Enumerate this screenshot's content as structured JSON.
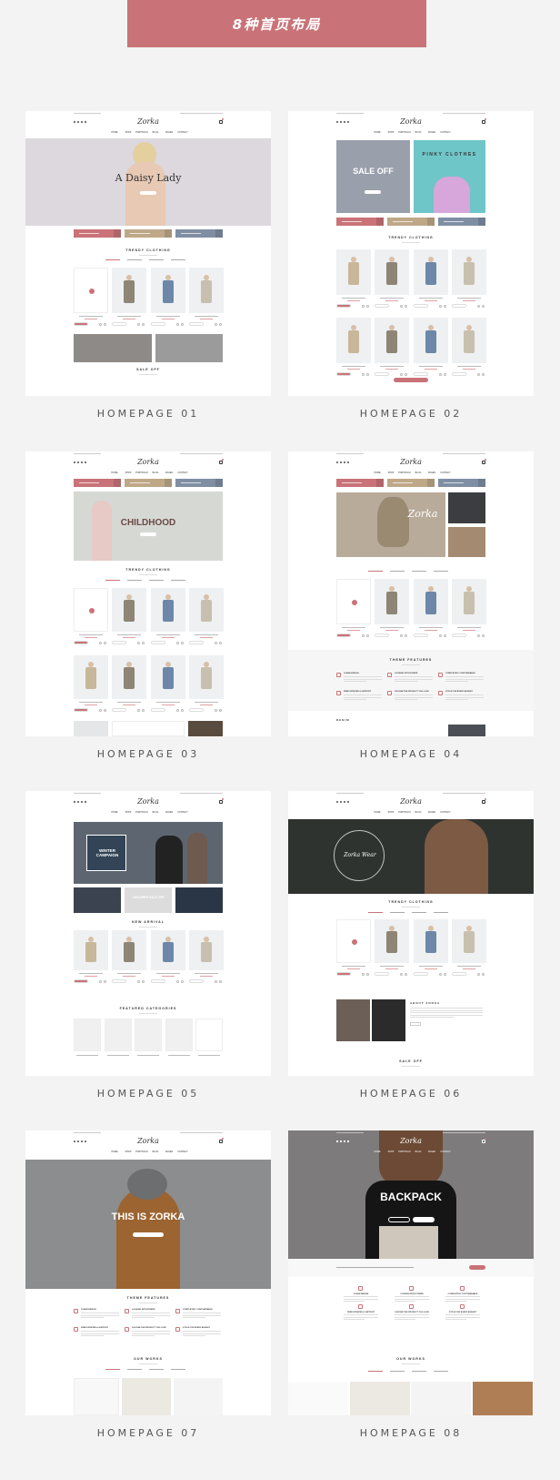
{
  "header": {
    "title": "8种首页布局"
  },
  "colors": {
    "accent": "#c97378",
    "tan": "#bfa888",
    "slate": "#7f8ea3",
    "page_bg": "#f3f3f3"
  },
  "common": {
    "logo": "Zorka",
    "nav": [
      "HOME",
      "SHOP",
      "PORTFOLIO",
      "BLOG",
      "PAGES",
      "CONTACT"
    ],
    "trendy": "TRENDY CLOTHING",
    "sale_off": "SALE OFF",
    "theme_features": "THEME FEATURES",
    "our_works": "OUR WORKS",
    "features": [
      "CLEAN DESIGN",
      "LOOKING WITH POWER",
      "COMPLETELY CUSTOMIZABLE",
      "FREE UPDATES & SUPPORT",
      "CHOOSE THE PRODUCT YOU LOVE",
      "STYLE FOR EVERY BUDGET"
    ]
  },
  "layouts": [
    {
      "label": "HOMEPAGE 01",
      "hero_title": "A Daisy Lady",
      "hero_color": "#dcd8dd"
    },
    {
      "label": "HOMEPAGE 02",
      "hero_title": "SALE OFF",
      "hero_title_2": "PINKY CLOTHES",
      "hero_color": "#9aa0ab",
      "hero_color_2": "#6fc6c8"
    },
    {
      "label": "HOMEPAGE 03",
      "hero_title": "CHILDHOOD",
      "hero_color": "#d6d8d4"
    },
    {
      "label": "HOMEPAGE 04",
      "hero_title": "Zorka",
      "hero_color": "#b8ab9a",
      "section": "DENIM"
    },
    {
      "label": "HOMEPAGE 05",
      "hero_title": "WINTER CAMPAIGN",
      "tile_title": "CHILDREN SALE OFF",
      "hero_color": "#5d6670",
      "section": "NEW ARRIVAL",
      "section_2": "FEATURED CATEGORIES"
    },
    {
      "label": "HOMEPAGE 06",
      "hero_title": "Zorka Wear",
      "hero_color": "#2f3330",
      "section": "ABOUT ZORKA"
    },
    {
      "label": "HOMEPAGE 07",
      "hero_title": "THIS IS ZORKA",
      "hero_color": "#8b8d8f"
    },
    {
      "label": "HOMEPAGE 08",
      "hero_title": "BACKPACK",
      "hero_color": "#7d7b7c"
    }
  ]
}
